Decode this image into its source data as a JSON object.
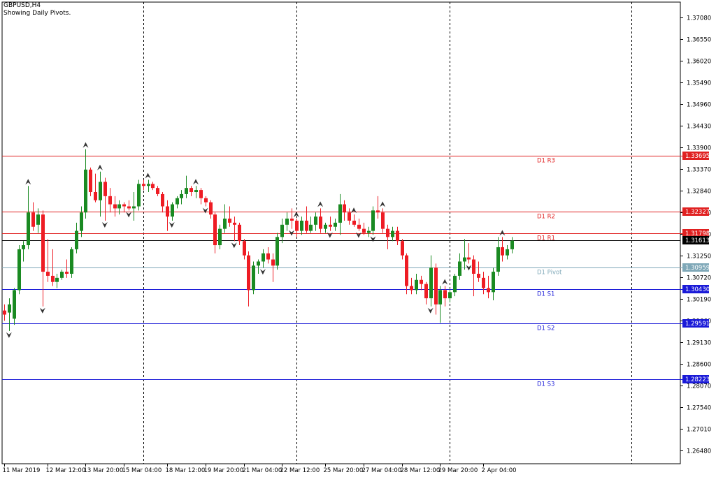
{
  "window": {
    "title": "GBPUSD,H4",
    "subtitle": "Showing Daily Pivots."
  },
  "colors": {
    "bull": "#1a8a22",
    "bear": "#ee1c24",
    "resistance": "#e02020",
    "support": "#1a1ad8",
    "pivot": "#7fa8b8",
    "current": "#000000",
    "frame": "#000000",
    "grid": "#000000",
    "axis_text": "#000000",
    "fractal": "#333333"
  },
  "chart_data": {
    "type": "candlestick",
    "symbol": "GBPUSD",
    "timeframe": "H4",
    "ylim": [
      1.2615,
      1.3745
    ],
    "y_ticks": [
      "1.37080",
      "1.36550",
      "1.36020",
      "1.35490",
      "1.34960",
      "1.34430",
      "1.33900",
      "1.33370",
      "1.32840",
      "1.32310",
      "1.31780",
      "1.31250",
      "1.30720",
      "1.30190",
      "1.29660",
      "1.29130",
      "1.28600",
      "1.28070",
      "1.27540",
      "1.27010",
      "1.26480"
    ],
    "x_labels": [
      {
        "label": "11 Mar 2019",
        "index": 0
      },
      {
        "label": "12 Mar 12:00",
        "index": 9
      },
      {
        "label": "13 Mar 20:00",
        "index": 17
      },
      {
        "label": "15 Mar 04:00",
        "index": 25
      },
      {
        "label": "18 Mar 12:00",
        "index": 34
      },
      {
        "label": "19 Mar 20:00",
        "index": 42
      },
      {
        "label": "21 Mar 04:00",
        "index": 50
      },
      {
        "label": "22 Mar 12:00",
        "index": 58
      },
      {
        "label": "25 Mar 20:00",
        "index": 67
      },
      {
        "label": "27 Mar 04:00",
        "index": 75
      },
      {
        "label": "28 Mar 12:00",
        "index": 83
      },
      {
        "label": "29 Mar 20:00",
        "index": 91
      },
      {
        "label": "2 Apr 04:00",
        "index": 100
      }
    ],
    "day_separators": [
      29,
      61,
      93,
      131
    ],
    "current_price": "1.31613",
    "levels": [
      {
        "name": "D1 R3",
        "value": "1.33695",
        "kind": "resistance"
      },
      {
        "name": "D1 R2",
        "value": "1.32327",
        "kind": "resistance"
      },
      {
        "name": "D1 R1",
        "value": "1.31798",
        "kind": "resistance"
      },
      {
        "name": "D1 Pivot",
        "value": "1.30959",
        "kind": "pivot"
      },
      {
        "name": "D1 S1",
        "value": "1.30430",
        "kind": "support"
      },
      {
        "name": "D1 S2",
        "value": "1.29591",
        "kind": "support"
      },
      {
        "name": "D1 S3",
        "value": "1.28223",
        "kind": "support"
      }
    ],
    "candles": [
      [
        1.299,
        1.3005,
        1.2965,
        1.298
      ],
      [
        1.2985,
        1.302,
        1.294,
        1.3005
      ],
      [
        1.297,
        1.3045,
        1.2955,
        1.304
      ],
      [
        1.304,
        1.315,
        1.303,
        1.314
      ],
      [
        1.314,
        1.316,
        1.311,
        1.315
      ],
      [
        1.315,
        1.3295,
        1.314,
        1.323
      ],
      [
        1.323,
        1.3255,
        1.3185,
        1.3195
      ],
      [
        1.32,
        1.324,
        1.318,
        1.3225
      ],
      [
        1.3225,
        1.3235,
        1.3,
        1.3085
      ],
      [
        1.3085,
        1.3165,
        1.306,
        1.3075
      ],
      [
        1.3075,
        1.314,
        1.305,
        1.306
      ],
      [
        1.306,
        1.308,
        1.3045,
        1.307
      ],
      [
        1.307,
        1.309,
        1.3065,
        1.3085
      ],
      [
        1.3085,
        1.3115,
        1.307,
        1.308
      ],
      [
        1.308,
        1.3145,
        1.307,
        1.314
      ],
      [
        1.314,
        1.3205,
        1.313,
        1.3185
      ],
      [
        1.3185,
        1.3245,
        1.317,
        1.323
      ],
      [
        1.323,
        1.3385,
        1.3215,
        1.3335
      ],
      [
        1.3335,
        1.334,
        1.327,
        1.328
      ],
      [
        1.328,
        1.3325,
        1.3255,
        1.326
      ],
      [
        1.326,
        1.333,
        1.322,
        1.3305
      ],
      [
        1.3305,
        1.3315,
        1.321,
        1.327
      ],
      [
        1.327,
        1.329,
        1.323,
        1.325
      ],
      [
        1.325,
        1.327,
        1.322,
        1.324
      ],
      [
        1.324,
        1.326,
        1.3225,
        1.325
      ],
      [
        1.325,
        1.3255,
        1.323,
        1.3245
      ],
      [
        1.3245,
        1.326,
        1.3235,
        1.324
      ],
      [
        1.324,
        1.328,
        1.321,
        1.3245
      ],
      [
        1.3245,
        1.331,
        1.3235,
        1.33
      ],
      [
        1.33,
        1.331,
        1.3285,
        1.3295
      ],
      [
        1.3295,
        1.331,
        1.328,
        1.33
      ],
      [
        1.33,
        1.3305,
        1.3285,
        1.329
      ],
      [
        1.329,
        1.3295,
        1.327,
        1.3275
      ],
      [
        1.3275,
        1.328,
        1.323,
        1.3245
      ],
      [
        1.3245,
        1.326,
        1.3185,
        1.322
      ],
      [
        1.322,
        1.3255,
        1.321,
        1.325
      ],
      [
        1.325,
        1.327,
        1.324,
        1.3265
      ],
      [
        1.3265,
        1.3285,
        1.325,
        1.3275
      ],
      [
        1.3275,
        1.332,
        1.3265,
        1.329
      ],
      [
        1.329,
        1.3295,
        1.327,
        1.328
      ],
      [
        1.328,
        1.3295,
        1.3265,
        1.3285
      ],
      [
        1.3285,
        1.329,
        1.325,
        1.3265
      ],
      [
        1.3265,
        1.327,
        1.3245,
        1.3255
      ],
      [
        1.3255,
        1.326,
        1.3215,
        1.3225
      ],
      [
        1.3225,
        1.323,
        1.313,
        1.315
      ],
      [
        1.315,
        1.32,
        1.314,
        1.319
      ],
      [
        1.319,
        1.325,
        1.318,
        1.3215
      ],
      [
        1.3215,
        1.3245,
        1.3195,
        1.3205
      ],
      [
        1.3205,
        1.322,
        1.316,
        1.32
      ],
      [
        1.32,
        1.3205,
        1.315,
        1.316
      ],
      [
        1.316,
        1.3165,
        1.3115,
        1.3125
      ],
      [
        1.3125,
        1.3135,
        1.3,
        1.304
      ],
      [
        1.304,
        1.311,
        1.303,
        1.31
      ],
      [
        1.31,
        1.3115,
        1.308,
        1.311
      ],
      [
        1.311,
        1.314,
        1.3095,
        1.313
      ],
      [
        1.313,
        1.3145,
        1.3105,
        1.3115
      ],
      [
        1.3115,
        1.313,
        1.306,
        1.31
      ],
      [
        1.31,
        1.318,
        1.309,
        1.317
      ],
      [
        1.317,
        1.3215,
        1.3155,
        1.32
      ],
      [
        1.32,
        1.323,
        1.3185,
        1.3215
      ],
      [
        1.3215,
        1.324,
        1.319,
        1.321
      ],
      [
        1.321,
        1.3215,
        1.317,
        1.3185
      ],
      [
        1.3185,
        1.322,
        1.3175,
        1.321
      ],
      [
        1.321,
        1.3245,
        1.318,
        1.3185
      ],
      [
        1.3185,
        1.322,
        1.318,
        1.32
      ],
      [
        1.32,
        1.323,
        1.3185,
        1.322
      ],
      [
        1.322,
        1.324,
        1.318,
        1.319
      ],
      [
        1.319,
        1.3205,
        1.318,
        1.32
      ],
      [
        1.32,
        1.322,
        1.3185,
        1.3195
      ],
      [
        1.3195,
        1.3215,
        1.3185,
        1.3205
      ],
      [
        1.3205,
        1.3275,
        1.3175,
        1.325
      ],
      [
        1.325,
        1.326,
        1.321,
        1.323
      ],
      [
        1.323,
        1.324,
        1.32,
        1.321
      ],
      [
        1.321,
        1.3225,
        1.3195,
        1.32
      ],
      [
        1.32,
        1.3215,
        1.3185,
        1.319
      ],
      [
        1.319,
        1.3205,
        1.3175,
        1.318
      ],
      [
        1.318,
        1.3195,
        1.317,
        1.3185
      ],
      [
        1.3185,
        1.3245,
        1.3175,
        1.3235
      ],
      [
        1.3235,
        1.327,
        1.3215,
        1.323
      ],
      [
        1.323,
        1.324,
        1.318,
        1.319
      ],
      [
        1.319,
        1.32,
        1.314,
        1.317
      ],
      [
        1.317,
        1.3195,
        1.316,
        1.3185
      ],
      [
        1.3185,
        1.3195,
        1.315,
        1.316
      ],
      [
        1.316,
        1.3165,
        1.3115,
        1.3125
      ],
      [
        1.3125,
        1.313,
        1.303,
        1.305
      ],
      [
        1.305,
        1.307,
        1.303,
        1.304
      ],
      [
        1.304,
        1.308,
        1.303,
        1.3065
      ],
      [
        1.3065,
        1.3075,
        1.304,
        1.3055
      ],
      [
        1.3055,
        1.306,
        1.3005,
        1.302
      ],
      [
        1.302,
        1.3125,
        1.3,
        1.3095
      ],
      [
        1.3095,
        1.3105,
        1.298,
        1.3005
      ],
      [
        1.3005,
        1.305,
        1.296,
        1.304
      ],
      [
        1.304,
        1.305,
        1.3,
        1.302
      ],
      [
        1.302,
        1.3045,
        1.301,
        1.3035
      ],
      [
        1.3035,
        1.308,
        1.3025,
        1.3075
      ],
      [
        1.3075,
        1.313,
        1.3065,
        1.311
      ],
      [
        1.311,
        1.3165,
        1.309,
        1.312
      ],
      [
        1.312,
        1.3155,
        1.3105,
        1.3115
      ],
      [
        1.3115,
        1.3125,
        1.3025,
        1.308
      ],
      [
        1.308,
        1.311,
        1.306,
        1.307
      ],
      [
        1.307,
        1.3085,
        1.303,
        1.3045
      ],
      [
        1.3045,
        1.3075,
        1.302,
        1.3035
      ],
      [
        1.3035,
        1.3095,
        1.3015,
        1.3085
      ],
      [
        1.3085,
        1.317,
        1.3075,
        1.3145
      ],
      [
        1.3145,
        1.317,
        1.311,
        1.3125
      ],
      [
        1.3125,
        1.315,
        1.3115,
        1.314
      ],
      [
        1.314,
        1.317,
        1.313,
        1.3161
      ]
    ],
    "fractals": [
      {
        "index": 1,
        "dir": "down"
      },
      {
        "index": 5,
        "dir": "up"
      },
      {
        "index": 8,
        "dir": "down"
      },
      {
        "index": 17,
        "dir": "up"
      },
      {
        "index": 20,
        "dir": "up"
      },
      {
        "index": 21,
        "dir": "down"
      },
      {
        "index": 26,
        "dir": "down"
      },
      {
        "index": 30,
        "dir": "up"
      },
      {
        "index": 35,
        "dir": "down"
      },
      {
        "index": 40,
        "dir": "up"
      },
      {
        "index": 42,
        "dir": "down"
      },
      {
        "index": 48,
        "dir": "down"
      },
      {
        "index": 54,
        "dir": "down"
      },
      {
        "index": 60,
        "dir": "down"
      },
      {
        "index": 61,
        "dir": "up"
      },
      {
        "index": 66,
        "dir": "up"
      },
      {
        "index": 68,
        "dir": "down"
      },
      {
        "index": 73,
        "dir": "up"
      },
      {
        "index": 74,
        "dir": "down"
      },
      {
        "index": 77,
        "dir": "down"
      },
      {
        "index": 79,
        "dir": "up"
      },
      {
        "index": 89,
        "dir": "down"
      },
      {
        "index": 92,
        "dir": "up"
      },
      {
        "index": 97,
        "dir": "down"
      },
      {
        "index": 104,
        "dir": "up"
      },
      {
        "index": 109,
        "dir": "down"
      },
      {
        "index": 114,
        "dir": "up"
      },
      {
        "index": 113,
        "dir": "down"
      }
    ]
  }
}
